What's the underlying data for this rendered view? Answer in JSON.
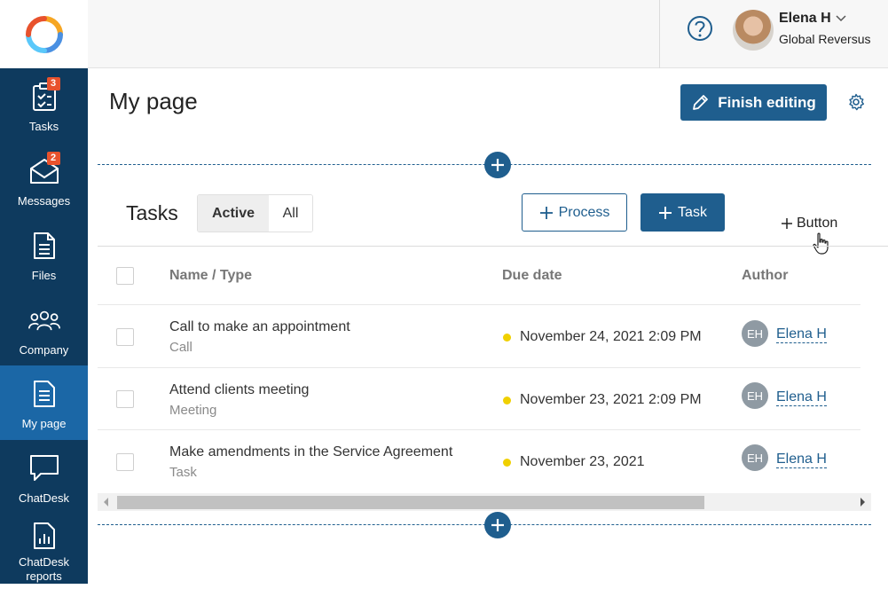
{
  "sidebar": {
    "items": [
      {
        "label": "Tasks",
        "icon": "clipboard-check-icon",
        "badge": "3"
      },
      {
        "label": "Messages",
        "icon": "envelope-icon",
        "badge": "2"
      },
      {
        "label": "Files",
        "icon": "file-icon"
      },
      {
        "label": "Company",
        "icon": "people-icon"
      },
      {
        "label": "My page",
        "icon": "page-icon",
        "active": true
      },
      {
        "label": "ChatDesk",
        "icon": "chat-bubble-icon"
      },
      {
        "label": "ChatDesk reports",
        "icon": "report-icon"
      }
    ]
  },
  "header": {
    "user_name": "Elena H",
    "company": "Global Reversus"
  },
  "page": {
    "title": "My page",
    "finish_editing_label": "Finish editing"
  },
  "tasks_widget": {
    "title": "Tasks",
    "tabs": [
      {
        "label": "Active"
      },
      {
        "label": "All"
      }
    ],
    "process_label": "Process",
    "task_label": "Task",
    "add_button_label": "Button",
    "columns": {
      "name": "Name / Type",
      "due": "Due date",
      "author": "Author"
    },
    "rows": [
      {
        "name": "Call to make an appointment",
        "type": "Call",
        "due": "November 24, 2021 2:09 PM",
        "author_initials": "EH",
        "author": "Elena H"
      },
      {
        "name": "Attend clients meeting",
        "type": "Meeting",
        "due": "November 23, 2021 2:09 PM",
        "author_initials": "EH",
        "author": "Elena H"
      },
      {
        "name": "Make amendments in the Service Agreement",
        "type": "Task",
        "due": "November 23, 2021",
        "author_initials": "EH",
        "author": "Elena H"
      }
    ]
  },
  "colors": {
    "sidebar_bg": "#0e3a5e",
    "sidebar_active": "#1b67a6",
    "accent": "#1f5e8e",
    "badge": "#e8522d",
    "due_dot": "#f0d000"
  }
}
